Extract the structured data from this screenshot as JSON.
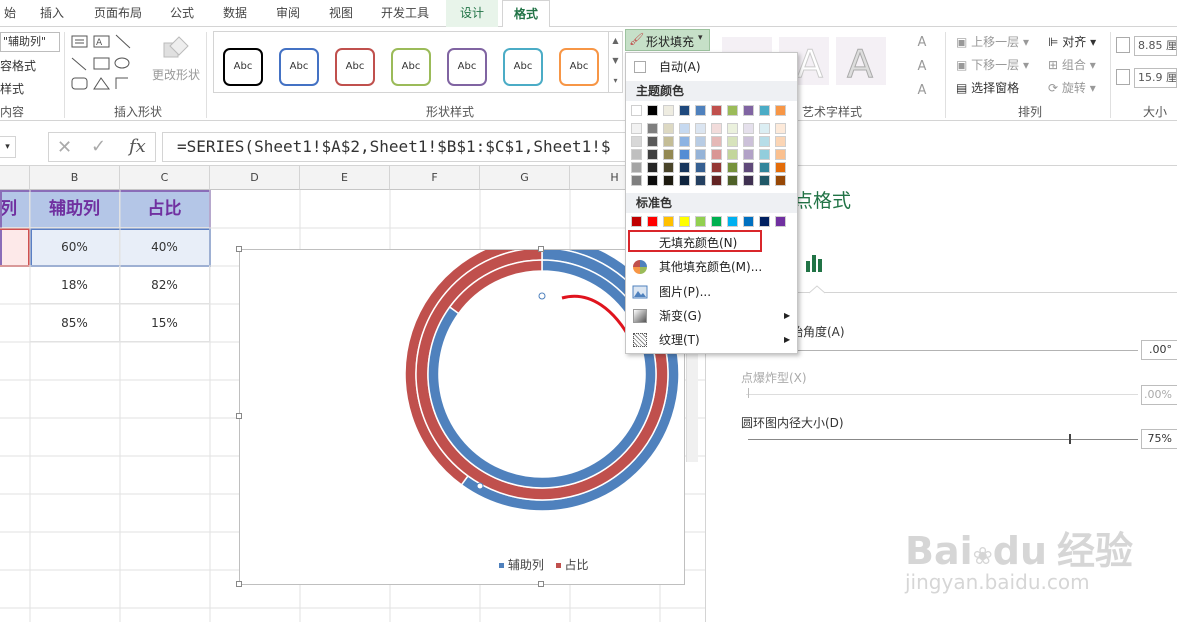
{
  "tabs": {
    "start": "始",
    "insert": "插入",
    "page_layout": "页面布局",
    "formulas": "公式",
    "data": "数据",
    "review": "审阅",
    "view": "视图",
    "developer": "开发工具",
    "design": "设计",
    "format": "格式"
  },
  "ribbon": {
    "series_selector": "\"辅助列\"",
    "format_selection": "容格式",
    "reset_style": "样式",
    "current_selection_label": "内容",
    "change_shape": "更改形状",
    "insert_shapes_label": "插入形状",
    "shape_styles_label": "形状样式",
    "abc": "Abc",
    "shape_fill": "形状填充",
    "wordart_label": "艺术字样式",
    "bring_forward": "上移一层",
    "send_backward": "下移一层",
    "selection_pane": "选择窗格",
    "align": "对齐",
    "group": "组合",
    "rotate": "旋转",
    "arrange_label": "排列",
    "height": "8.85 厘",
    "width": "15.9 厘",
    "size_label": "大小"
  },
  "style_colors": [
    "#000000",
    "#4472c4",
    "#c0504d",
    "#9bbb59",
    "#8064a2",
    "#4bacc6",
    "#f79646"
  ],
  "formula": {
    "cancel": "✕",
    "confirm": "✓",
    "fx": "fx",
    "text": "=SERIES(Sheet1!$A$2,Sheet1!$B$1:$C$1,Sheet1!$"
  },
  "sheet": {
    "columns": [
      "B",
      "C",
      "D",
      "E",
      "F",
      "G",
      "H"
    ],
    "row_label_a": "列",
    "headers": [
      "辅助列",
      "占比"
    ],
    "rows": [
      [
        "60%",
        "40%"
      ],
      [
        "18%",
        "82%"
      ],
      [
        "85%",
        "15%"
      ]
    ]
  },
  "chart_data": {
    "type": "doughnut",
    "categories": [
      "辅助列",
      "占比"
    ],
    "series": [
      {
        "values": [
          60,
          40
        ]
      },
      {
        "values": [
          18,
          82
        ]
      },
      {
        "values": [
          85,
          15
        ]
      }
    ],
    "colors": [
      "#4f81bd",
      "#c0504d"
    ],
    "legend": "bottom"
  },
  "menu": {
    "automatic": "自动(A)",
    "theme_colors": "主题颜色",
    "standard_colors": "标准色",
    "no_fill": "无填充颜色(N)",
    "more_colors": "其他填充颜色(M)...",
    "picture": "图片(P)...",
    "gradient": "渐变(G)",
    "texture": "纹理(T)",
    "theme_base": [
      "#ffffff",
      "#000000",
      "#eeece1",
      "#1f497d",
      "#4f81bd",
      "#c0504d",
      "#9bbb59",
      "#8064a2",
      "#4bacc6",
      "#f79646"
    ],
    "theme_shades": [
      [
        "#f2f2f2",
        "#7f7f7f",
        "#ddd9c3",
        "#c6d9f0",
        "#dbe5f1",
        "#f2dcdb",
        "#ebf1dd",
        "#e5e0ec",
        "#dbeef3",
        "#fdeada"
      ],
      [
        "#d8d8d8",
        "#595959",
        "#c4bd97",
        "#8db3e2",
        "#b8cce4",
        "#e5b9b7",
        "#d7e3bc",
        "#ccc1d9",
        "#b7dde8",
        "#fbd5b5"
      ],
      [
        "#bfbfbf",
        "#3f3f3f",
        "#938953",
        "#548dd4",
        "#95b3d7",
        "#d99694",
        "#c3d69b",
        "#b2a2c7",
        "#92cddc",
        "#fac08f"
      ],
      [
        "#a5a5a5",
        "#262626",
        "#494429",
        "#17365d",
        "#366092",
        "#953734",
        "#76923c",
        "#5f497a",
        "#31859b",
        "#e36c09"
      ],
      [
        "#7f7f7f",
        "#0c0c0c",
        "#1d1b10",
        "#0f243e",
        "#244061",
        "#632423",
        "#4f6128",
        "#3f3151",
        "#205867",
        "#974806"
      ]
    ],
    "standard": [
      "#c00000",
      "#ff0000",
      "#ffc000",
      "#ffff00",
      "#92d050",
      "#00b050",
      "#00b0f0",
      "#0070c0",
      "#002060",
      "#7030a0"
    ]
  },
  "panel": {
    "title": "点格式",
    "first_slice": "始角度(A)",
    "first_slice_value": ".00°",
    "explosion": "点爆炸型(X)",
    "explosion_value": ".00%",
    "hole_size": "圆环图内径大小(D)",
    "hole_value": "75%"
  },
  "watermark": {
    "brand": "Bai",
    "brand2": "du",
    "cn": "经验",
    "url": "jingyan.baidu.com"
  }
}
